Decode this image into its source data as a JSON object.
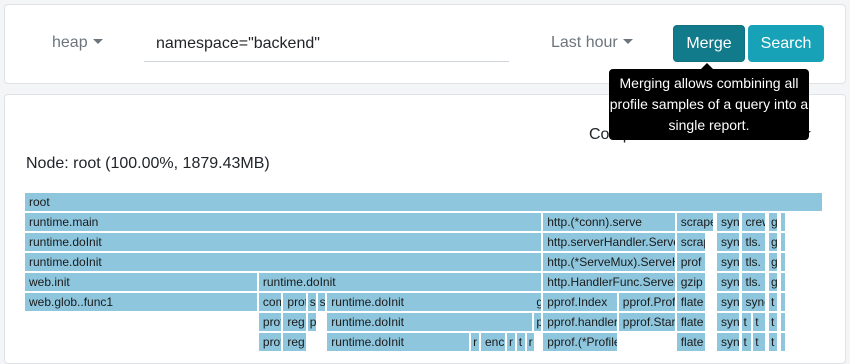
{
  "toolbar": {
    "profile_type": "heap",
    "query_value": "namespace=\"backend\"",
    "time_range": "Last hour",
    "merge_label": "Merge",
    "search_label": "Search"
  },
  "tooltip": {
    "text": "Merging allows combining all profile samples of a query into a single report."
  },
  "panel": {
    "compare_label": "Compare",
    "share_label": "Share",
    "node_label": "Node: root (100.00%, 1879.43MB)"
  },
  "colors": {
    "accent": "#17a2b8",
    "accent_dark": "#117a8b",
    "frame": "#8ec6de"
  },
  "flamegraph": {
    "frames": [
      {
        "label": "root",
        "depth": 0,
        "start": 0.0,
        "end": 1.0
      },
      {
        "label": "runtime.main",
        "depth": 1,
        "start": 0.0,
        "end": 0.6486
      },
      {
        "label": "runtime.doInit",
        "depth": 2,
        "start": 0.0,
        "end": 0.6486
      },
      {
        "label": "runtime.doInit",
        "depth": 3,
        "start": 0.0,
        "end": 0.6486
      },
      {
        "label": "web.init",
        "depth": 4,
        "start": 0.0,
        "end": 0.2928
      },
      {
        "label": "web.glob..func1",
        "depth": 5,
        "start": 0.0,
        "end": 0.2928
      },
      {
        "label": "runtime.doInit",
        "depth": 4,
        "start": 0.2928,
        "end": 0.6486
      },
      {
        "label": "compress",
        "depth": 5,
        "start": 0.2928,
        "end": 0.3234
      },
      {
        "label": "proto",
        "depth": 5,
        "start": 0.3234,
        "end": 0.3539
      },
      {
        "label": "s",
        "depth": 5,
        "start": 0.3539,
        "end": 0.3662
      },
      {
        "label": "s",
        "depth": 5,
        "start": 0.3662,
        "end": 0.3784
      },
      {
        "label": "runtime.doInit",
        "depth": 5,
        "start": 0.3784,
        "end": 0.6486
      },
      {
        "label": "proto",
        "depth": 6,
        "start": 0.2928,
        "end": 0.3234
      },
      {
        "label": "reg",
        "depth": 6,
        "start": 0.3234,
        "end": 0.3539
      },
      {
        "label": "p",
        "depth": 6,
        "start": 0.3539,
        "end": 0.3662
      },
      {
        "label": "proto",
        "depth": 7,
        "start": 0.2928,
        "end": 0.3234
      },
      {
        "label": "reg",
        "depth": 7,
        "start": 0.3234,
        "end": 0.3539
      },
      {
        "label": "runtime.doInit",
        "depth": 6,
        "start": 0.3784,
        "end": 0.6375
      },
      {
        "label": "p",
        "depth": 6,
        "start": 0.6375,
        "end": 0.6486
      },
      {
        "label": "runtime.doInit",
        "depth": 7,
        "start": 0.3784,
        "end": 0.5583
      },
      {
        "label": "r",
        "depth": 7,
        "start": 0.5583,
        "end": 0.5707
      },
      {
        "label": "enc",
        "depth": 7,
        "start": 0.5707,
        "end": 0.6032
      },
      {
        "label": "r",
        "depth": 7,
        "start": 0.6032,
        "end": 0.6155
      },
      {
        "label": "t",
        "depth": 7,
        "start": 0.6155,
        "end": 0.6278
      },
      {
        "label": "r",
        "depth": 7,
        "start": 0.6278,
        "end": 0.6402
      },
      {
        "label": "g",
        "depth": 5,
        "start": 0.6375,
        "end": 0.6486
      },
      {
        "label": "http.(*conn).serve",
        "depth": 1,
        "start": 0.6486,
        "end": 0.8157
      },
      {
        "label": "http.serverHandler.ServeHTTP",
        "depth": 2,
        "start": 0.6486,
        "end": 0.8157
      },
      {
        "label": "http.(*ServeMux).ServeHTTP",
        "depth": 3,
        "start": 0.6486,
        "end": 0.8157
      },
      {
        "label": "http.HandlerFunc.ServeHTTP",
        "depth": 4,
        "start": 0.6486,
        "end": 0.8157
      },
      {
        "label": "pprof.Index",
        "depth": 5,
        "start": 0.6486,
        "end": 0.7432
      },
      {
        "label": "pprof.Profile",
        "depth": 5,
        "start": 0.7432,
        "end": 0.8157
      },
      {
        "label": "pprof.handler",
        "depth": 6,
        "start": 0.6486,
        "end": 0.7432
      },
      {
        "label": "pprof.StartCPUProfile",
        "depth": 6,
        "start": 0.7432,
        "end": 0.8157
      },
      {
        "label": "pprof.(*Profile)",
        "depth": 7,
        "start": 0.6486,
        "end": 0.7432
      },
      {
        "label": "scrape",
        "depth": 1,
        "start": 0.8157,
        "end": 0.8636
      },
      {
        "label": "scrape",
        "depth": 2,
        "start": 0.8157,
        "end": 0.8538
      },
      {
        "label": "prof",
        "depth": 3,
        "start": 0.8157,
        "end": 0.8538
      },
      {
        "label": "gzip",
        "depth": 4,
        "start": 0.8157,
        "end": 0.8538
      },
      {
        "label": "flate",
        "depth": 5,
        "start": 0.8157,
        "end": 0.8538
      },
      {
        "label": "flate",
        "depth": 6,
        "start": 0.8157,
        "end": 0.8538
      },
      {
        "label": "flate",
        "depth": 7,
        "start": 0.8157,
        "end": 0.8538
      },
      {
        "label": "sync",
        "depth": 1,
        "start": 0.8661,
        "end": 0.8956
      },
      {
        "label": "sync",
        "depth": 2,
        "start": 0.8661,
        "end": 0.8956
      },
      {
        "label": "sync",
        "depth": 3,
        "start": 0.8661,
        "end": 0.8956
      },
      {
        "label": "sync",
        "depth": 4,
        "start": 0.8661,
        "end": 0.8956
      },
      {
        "label": "sync",
        "depth": 5,
        "start": 0.8661,
        "end": 0.8956
      },
      {
        "label": "sync",
        "depth": 6,
        "start": 0.8661,
        "end": 0.8956
      },
      {
        "label": "sync",
        "depth": 7,
        "start": 0.8661,
        "end": 0.8956
      },
      {
        "label": "crew",
        "depth": 1,
        "start": 0.8968,
        "end": 0.9287
      },
      {
        "label": "tls.",
        "depth": 2,
        "start": 0.8968,
        "end": 0.9287
      },
      {
        "label": "tls.",
        "depth": 3,
        "start": 0.8968,
        "end": 0.9287
      },
      {
        "label": "tls.",
        "depth": 4,
        "start": 0.8968,
        "end": 0.9287
      },
      {
        "label": "sync",
        "depth": 5,
        "start": 0.8968,
        "end": 0.9287
      },
      {
        "label": "t",
        "depth": 6,
        "start": 0.8968,
        "end": 0.9115
      },
      {
        "label": "t",
        "depth": 6,
        "start": 0.9115,
        "end": 0.9287
      },
      {
        "label": "t",
        "depth": 7,
        "start": 0.8968,
        "end": 0.9115
      },
      {
        "label": "t",
        "depth": 7,
        "start": 0.9115,
        "end": 0.9287
      },
      {
        "label": "g",
        "depth": 1,
        "start": 0.9312,
        "end": 0.9435
      },
      {
        "label": "g",
        "depth": 2,
        "start": 0.9312,
        "end": 0.9435
      },
      {
        "label": "g",
        "depth": 3,
        "start": 0.9312,
        "end": 0.9435
      },
      {
        "label": "g",
        "depth": 4,
        "start": 0.9312,
        "end": 0.9435
      },
      {
        "label": "t",
        "depth": 5,
        "start": 0.9312,
        "end": 0.9435
      },
      {
        "label": "t",
        "depth": 6,
        "start": 0.9312,
        "end": 0.9435
      },
      {
        "label": "t",
        "depth": 7,
        "start": 0.9312,
        "end": 0.9435
      },
      {
        "label": "",
        "depth": 1,
        "start": 0.9459,
        "end": 0.9533
      },
      {
        "label": "",
        "depth": 2,
        "start": 0.9459,
        "end": 0.9533
      },
      {
        "label": "",
        "depth": 3,
        "start": 0.9459,
        "end": 0.9533
      },
      {
        "label": "",
        "depth": 4,
        "start": 0.9459,
        "end": 0.9533
      },
      {
        "label": "",
        "depth": 5,
        "start": 0.9459,
        "end": 0.9533
      },
      {
        "label": "",
        "depth": 6,
        "start": 0.9459,
        "end": 0.9533
      },
      {
        "label": "",
        "depth": 7,
        "start": 0.9459,
        "end": 0.9533
      }
    ]
  }
}
